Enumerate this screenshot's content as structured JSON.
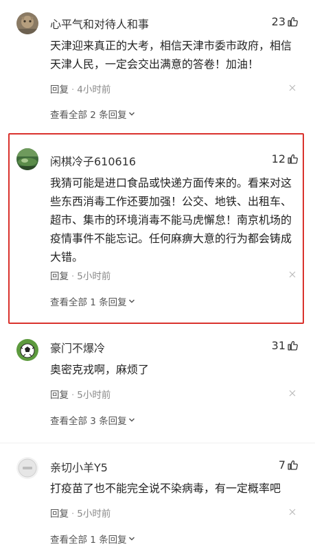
{
  "comments": [
    {
      "username": "心平气和对待人和事",
      "likes": "23",
      "text": "天津迎来真正的大考，相信天津市委市政府，相信天津人民，一定会交出满意的答卷！加油！",
      "reply_label": "回复",
      "time": "4小时前",
      "view_all": "查看全部 2 条回复"
    },
    {
      "username": "闲棋冷子610616",
      "likes": "12",
      "text": "我猜可能是进口食品或快递方面传来的。看来对这些东西消毒工作还要加强！公交、地铁、出租车、超市、集市的环境消毒不能马虎懈怠！南京机场的疫情事件不能忘记。任何麻痹大意的行为都会铸成大错。",
      "reply_label": "回复",
      "time": "5小时前",
      "view_all": "查看全部 1 条回复"
    },
    {
      "username": "豪门不爆冷",
      "likes": "31",
      "text": "奥密克戎啊，麻烦了",
      "reply_label": "回复",
      "time": "5小时前",
      "view_all": "查看全部 3 条回复"
    },
    {
      "username": "亲切小羊Y5",
      "likes": "7",
      "text": "打疫苗了也不能完全说不染病毒，有一定概率吧",
      "reply_label": "回复",
      "time": "5小时前",
      "view_all": "查看全部 1 条回复"
    }
  ],
  "colors": {
    "highlight_border": "#d9302b",
    "meta_text": "#888888"
  },
  "icons": [
    "thumbs-up-icon",
    "close-icon",
    "chevron-down-icon"
  ]
}
